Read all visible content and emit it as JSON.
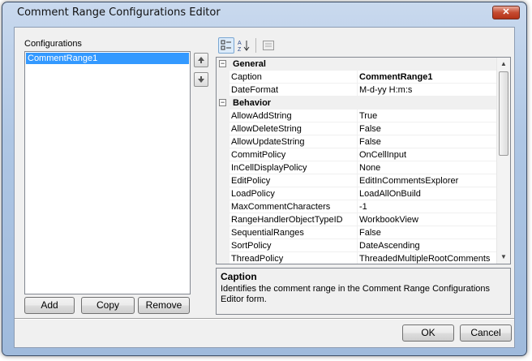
{
  "window": {
    "title": "Comment Range Configurations Editor",
    "close_glyph": "✕"
  },
  "configurations": {
    "label": "Configurations",
    "items": [
      "CommentRange1"
    ],
    "move_up_icon": "arrow-up-icon",
    "move_down_icon": "arrow-down-icon"
  },
  "buttons": {
    "add": "Add",
    "copy": "Copy",
    "remove": "Remove",
    "ok": "OK",
    "cancel": "Cancel"
  },
  "toolbar": {
    "categorized_icon": "categorized-icon",
    "alphabetical_icon": "sort-alpha-icon",
    "property_pages_icon": "property-pages-icon"
  },
  "property_grid": {
    "categories": [
      {
        "name": "General",
        "properties": [
          {
            "name": "Caption",
            "value": "CommentRange1"
          },
          {
            "name": "DateFormat",
            "value": "M-d-yy H:m:s"
          }
        ]
      },
      {
        "name": "Behavior",
        "properties": [
          {
            "name": "AllowAddString",
            "value": "True"
          },
          {
            "name": "AllowDeleteString",
            "value": "False"
          },
          {
            "name": "AllowUpdateString",
            "value": "False"
          },
          {
            "name": "CommitPolicy",
            "value": "OnCellInput"
          },
          {
            "name": "InCellDisplayPolicy",
            "value": "None"
          },
          {
            "name": "EditPolicy",
            "value": "EditInCommentsExplorer"
          },
          {
            "name": "LoadPolicy",
            "value": "LoadAllOnBuild"
          },
          {
            "name": "MaxCommentCharacters",
            "value": "-1"
          },
          {
            "name": "RangeHandlerObjectTypeID",
            "value": "WorkbookView"
          },
          {
            "name": "SequentialRanges",
            "value": "False"
          },
          {
            "name": "SortPolicy",
            "value": "DateAscending"
          },
          {
            "name": "ThreadPolicy",
            "value": "ThreadedMultipleRootComments"
          }
        ]
      }
    ],
    "selected": "Caption"
  },
  "description": {
    "title": "Caption",
    "text": "Identifies the comment range in the Comment Range Configurations Editor form."
  }
}
